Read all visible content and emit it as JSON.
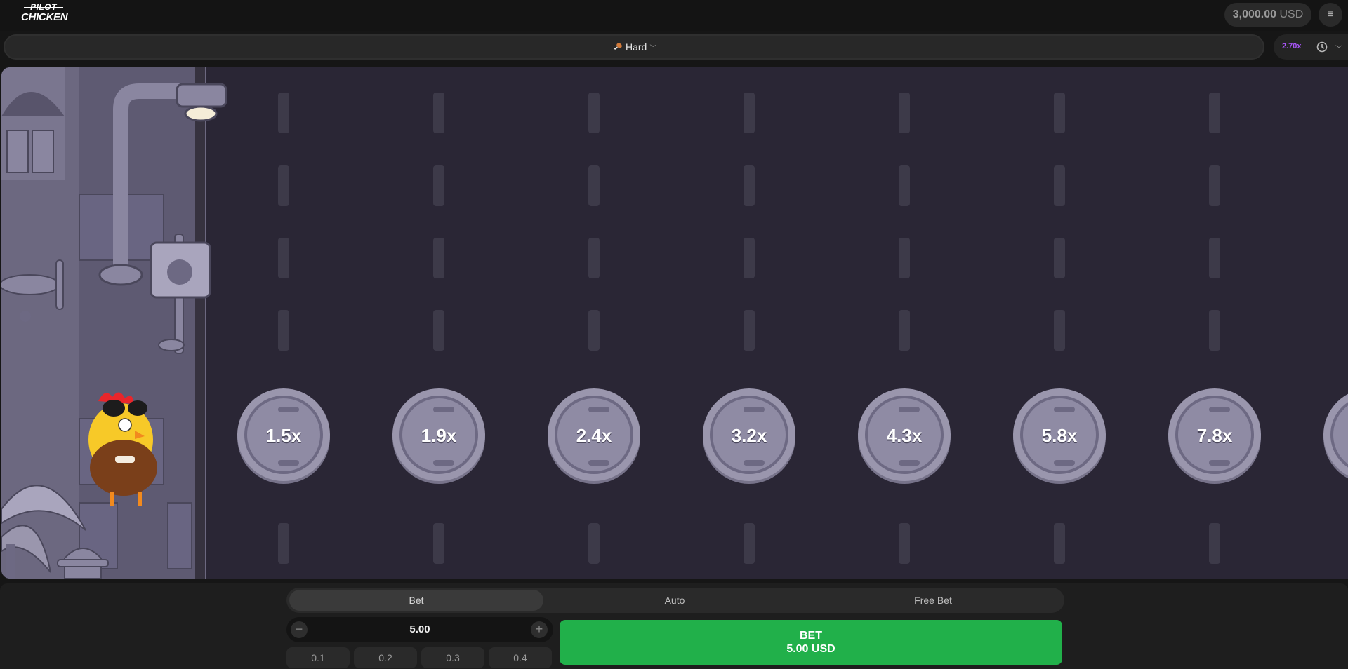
{
  "app": {
    "logo_line1": "PILOT",
    "logo_line2": "CHICKEN"
  },
  "header": {
    "balance_amount": "3,000.00",
    "balance_currency": "USD",
    "menu_icon": "menu-icon"
  },
  "difficulty": {
    "label": "Hard",
    "icon": "chicken-leg-icon",
    "open_icon": "chevron-down-icon"
  },
  "history": {
    "last_multiplier": "2.70x",
    "icon": "history-clock-icon",
    "open_icon": "chevron-down-icon"
  },
  "lanes": {
    "multipliers": [
      "1.5x",
      "1.9x",
      "2.4x",
      "3.2x",
      "4.3x",
      "5.8x",
      "7.8x"
    ]
  },
  "bet_panel": {
    "tabs": [
      "Bet",
      "Auto",
      "Free Bet"
    ],
    "active_tab": "Bet",
    "amount": "5.00",
    "quick_amounts": [
      "0.1",
      "0.2",
      "0.3",
      "0.4"
    ],
    "bet_button_line1": "BET",
    "bet_button_line2": "5.00 USD"
  },
  "colors": {
    "accent_green": "#21b04a",
    "history_purple": "#a855f7",
    "road": "#2a2635"
  }
}
